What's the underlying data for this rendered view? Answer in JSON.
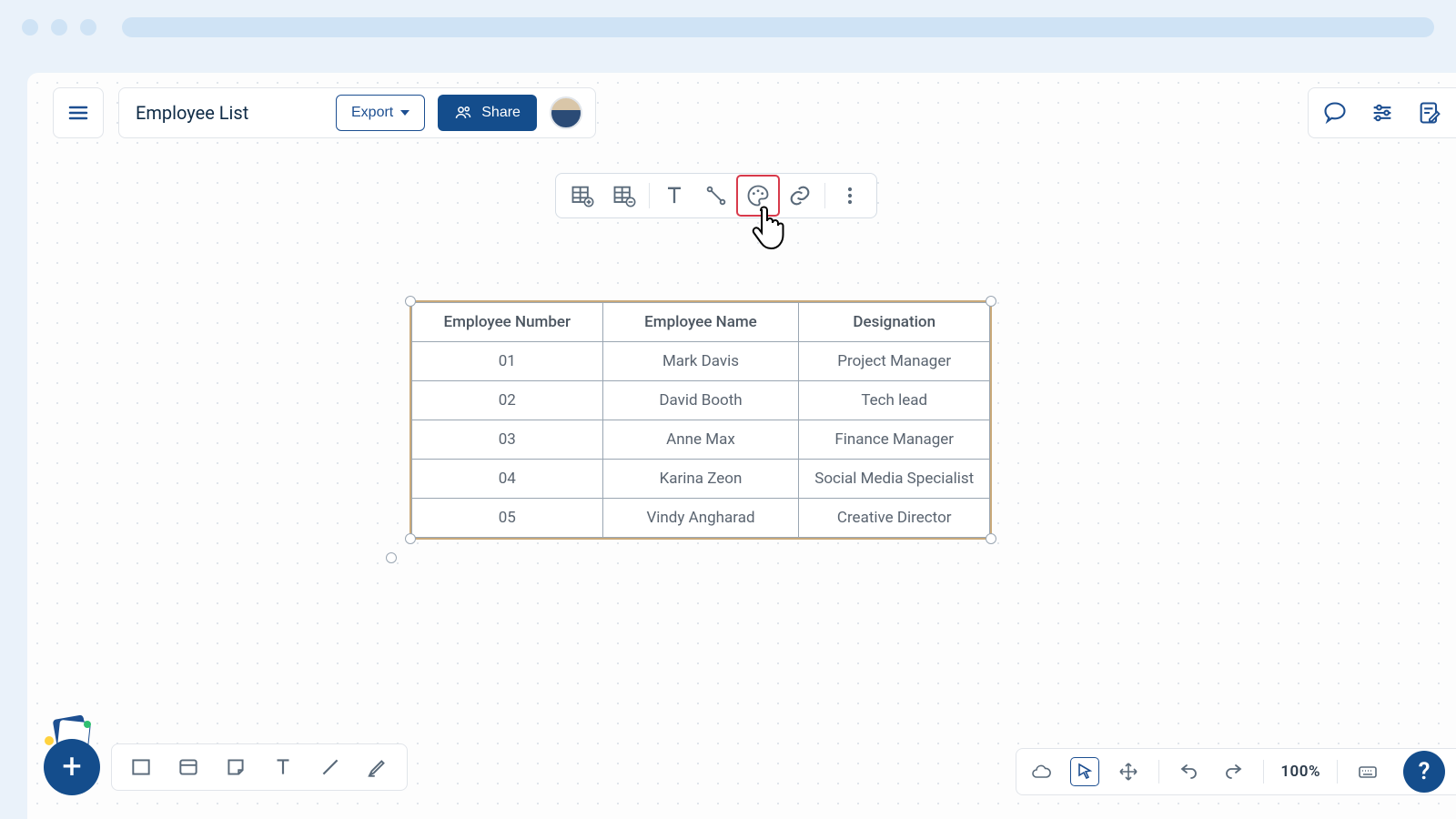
{
  "browser": {
    "traffic_dots": 3
  },
  "header": {
    "document_title": "Employee List",
    "export_label": "Export",
    "share_label": "Share"
  },
  "context_toolbar": {
    "items": [
      {
        "name": "add-row-column-icon"
      },
      {
        "name": "remove-row-column-icon"
      },
      {
        "name": "text-tool-icon"
      },
      {
        "name": "line-tool-icon"
      },
      {
        "name": "style-palette-icon",
        "highlighted": true
      },
      {
        "name": "link-icon"
      },
      {
        "name": "more-options-icon"
      }
    ]
  },
  "table": {
    "headers": [
      "Employee Number",
      "Employee Name",
      "Designation"
    ],
    "rows": [
      [
        "01",
        "Mark Davis",
        "Project Manager"
      ],
      [
        "02",
        "David Booth",
        "Tech lead"
      ],
      [
        "03",
        "Anne Max",
        "Finance Manager"
      ],
      [
        "04",
        "Karina Zeon",
        "Social Media Specialist"
      ],
      [
        "05",
        "Vindy Angharad",
        "Creative Director"
      ]
    ]
  },
  "bottom_toolbar": {
    "items": [
      "rectangle",
      "card",
      "sticky-note",
      "text",
      "line",
      "highlighter"
    ]
  },
  "bottom_right": {
    "zoom": "100%",
    "help": "?"
  }
}
